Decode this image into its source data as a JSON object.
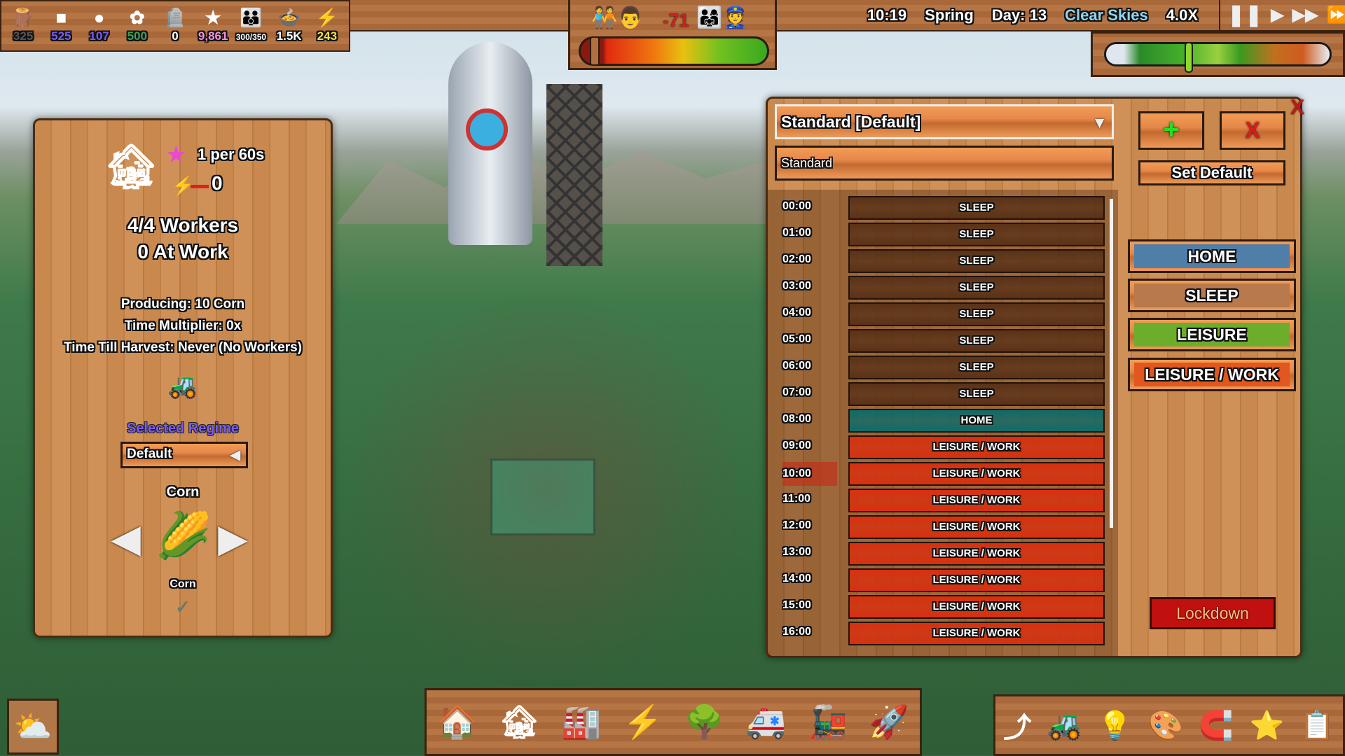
{
  "resources": [
    {
      "icon": "log-icon",
      "glyph": "🪵",
      "value": "325",
      "color": "#555555"
    },
    {
      "icon": "crystal-icon",
      "glyph": "■",
      "value": "525",
      "color": "#7a5cf0"
    },
    {
      "icon": "coal-icon",
      "glyph": "●",
      "value": "107",
      "color": "#7a5cf0"
    },
    {
      "icon": "flower-icon",
      "glyph": "✿",
      "value": "500",
      "color": "#3fa05a"
    },
    {
      "icon": "gravestone-icon",
      "glyph": "🪦",
      "value": "0",
      "color": "#ffffff"
    },
    {
      "icon": "rainbow-star-icon",
      "glyph": "★",
      "value": "9,861",
      "color": "#f090e0"
    },
    {
      "icon": "family-icon",
      "glyph": "👪",
      "value": "300/350",
      "color": "#ffffff"
    },
    {
      "icon": "food-bowl-icon",
      "glyph": "🍲",
      "value": "1.5K",
      "color": "#ffffff"
    },
    {
      "icon": "lightning-icon",
      "glyph": "⚡",
      "value": "243",
      "color": "#f5e04a"
    }
  ],
  "status": {
    "time": "10:19",
    "season": "Spring",
    "day": "Day: 13",
    "weather": "Clear Skies",
    "speed": "4.0X",
    "weather_color": "#8fd3f0"
  },
  "happiness": {
    "value": "-71",
    "level_percent": 5
  },
  "season_slider": {
    "position_percent": 37
  },
  "building": {
    "production_rate": "1 per 60s",
    "power": "0",
    "workers": "4/4 Workers",
    "at_work": "0 At Work",
    "producing": "Producing: 10 Corn",
    "time_multiplier": "Time Multiplier: 0x",
    "harvest": "Time Till Harvest: Never (No Workers)",
    "regime_label": "Selected Regime",
    "regime_value": "Default",
    "crop_title": "Corn",
    "crop_name": "Corn"
  },
  "schedule": {
    "selected": "Standard [Default]",
    "name_field": "Standard",
    "add": "+",
    "delete": "X",
    "set_default": "Set Default",
    "close": "X",
    "rows": [
      {
        "time": "00:00",
        "activity": "SLEEP"
      },
      {
        "time": "01:00",
        "activity": "SLEEP"
      },
      {
        "time": "02:00",
        "activity": "SLEEP"
      },
      {
        "time": "03:00",
        "activity": "SLEEP"
      },
      {
        "time": "04:00",
        "activity": "SLEEP"
      },
      {
        "time": "05:00",
        "activity": "SLEEP"
      },
      {
        "time": "06:00",
        "activity": "SLEEP"
      },
      {
        "time": "07:00",
        "activity": "SLEEP"
      },
      {
        "time": "08:00",
        "activity": "HOME"
      },
      {
        "time": "09:00",
        "activity": "LEISURE / WORK"
      },
      {
        "time": "10:00",
        "activity": "LEISURE / WORK",
        "current": true
      },
      {
        "time": "11:00",
        "activity": "LEISURE / WORK"
      },
      {
        "time": "12:00",
        "activity": "LEISURE / WORK"
      },
      {
        "time": "13:00",
        "activity": "LEISURE / WORK"
      },
      {
        "time": "14:00",
        "activity": "LEISURE / WORK"
      },
      {
        "time": "15:00",
        "activity": "LEISURE / WORK"
      },
      {
        "time": "16:00",
        "activity": "LEISURE / WORK"
      }
    ],
    "legend": [
      {
        "label": "HOME",
        "color": "#4f7fa8"
      },
      {
        "label": "SLEEP",
        "color": "#b87a4c"
      },
      {
        "label": "LEISURE",
        "color": "#6cae2c"
      },
      {
        "label": "LEISURE / WORK",
        "color": "#e2561f"
      }
    ],
    "activity_colors": {
      "SLEEP": "#5a3218",
      "HOME": "#0f6b68",
      "LEISURE / WORK": "#d8300f"
    },
    "lockdown": "Lockdown"
  },
  "toolbar": [
    "house-icon",
    "farm-icon",
    "workshop-icon",
    "power-icon",
    "park-icon",
    "hospital-icon",
    "train-icon",
    "rocket-icon"
  ],
  "toolbar_right": [
    "route-icon",
    "bulldozer-icon",
    "lightbulb-icon",
    "color-wheel-icon",
    "magnet-icon",
    "star-icon",
    "list-icon"
  ]
}
